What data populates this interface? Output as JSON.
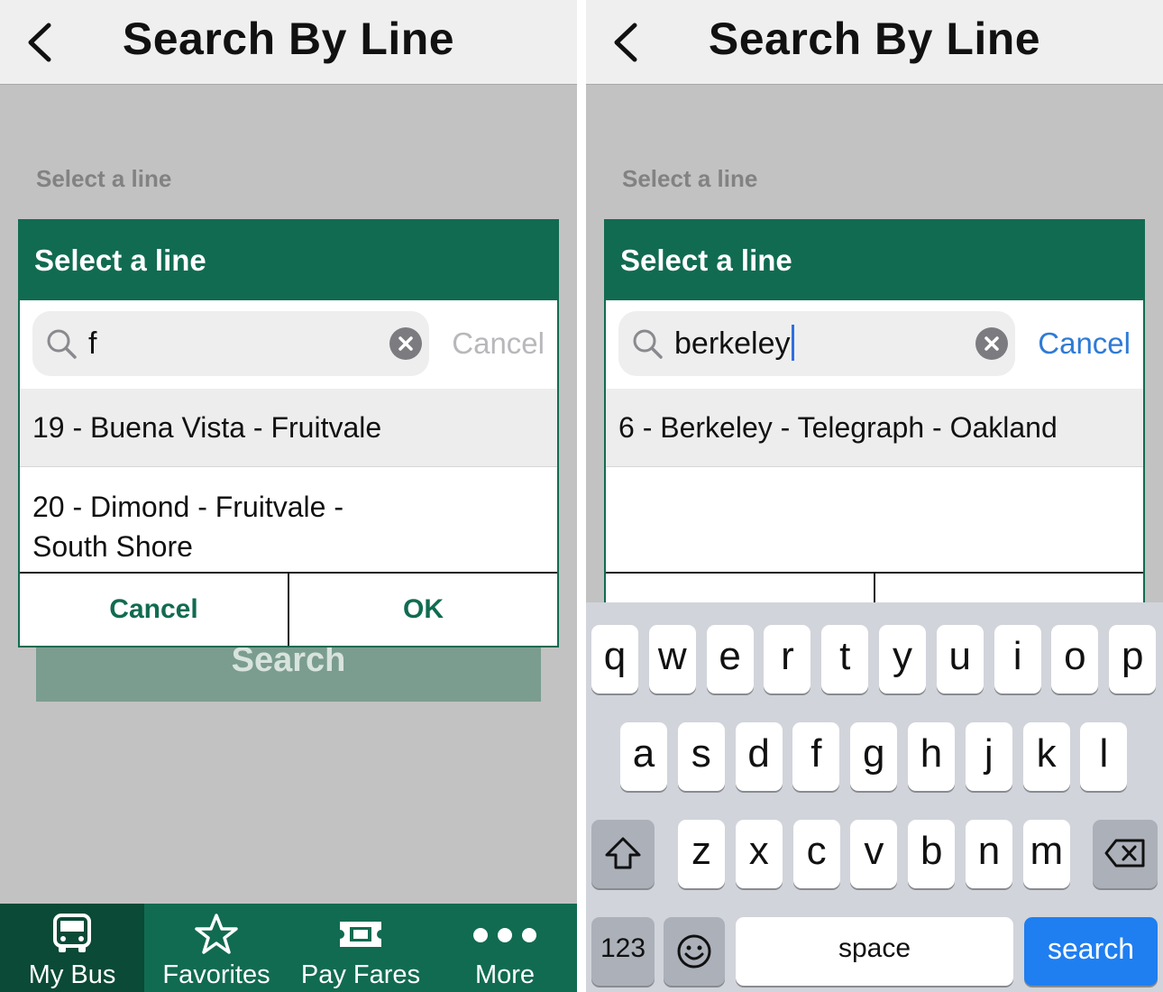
{
  "colors": {
    "brand_green": "#116b51",
    "tab_active": "#0a4a36",
    "ios_blue": "#2e7bd6",
    "search_key_blue": "#1f7ef0"
  },
  "left": {
    "nav_title": "Search By Line",
    "select_label": "Select a line",
    "search_button": "Search",
    "dialog": {
      "title": "Select a line",
      "search_value": "f",
      "cancel_link": "Cancel",
      "results": [
        "19 - Buena Vista - Fruitvale",
        "20 - Dimond - Fruitvale - South Shore"
      ],
      "cancel_button": "Cancel",
      "ok_button": "OK"
    },
    "tabs": [
      {
        "label": "My Bus",
        "icon": "bus-icon",
        "active": true
      },
      {
        "label": "Favorites",
        "icon": "star-icon",
        "active": false
      },
      {
        "label": "Pay Fares",
        "icon": "ticket-icon",
        "active": false
      },
      {
        "label": "More",
        "icon": "more-dots-icon",
        "active": false
      }
    ]
  },
  "right": {
    "nav_title": "Search By Line",
    "select_label": "Select a line",
    "dialog": {
      "title": "Select a line",
      "search_value": "berkeley",
      "cancel_link": "Cancel",
      "results": [
        "6 - Berkeley - Telegraph - Oakland"
      ]
    },
    "keyboard": {
      "row1": [
        "q",
        "w",
        "e",
        "r",
        "t",
        "y",
        "u",
        "i",
        "o",
        "p"
      ],
      "row2": [
        "a",
        "s",
        "d",
        "f",
        "g",
        "h",
        "j",
        "k",
        "l"
      ],
      "row3": [
        "z",
        "x",
        "c",
        "v",
        "b",
        "n",
        "m"
      ],
      "numbers_key": "123",
      "space_key": "space",
      "search_key": "search",
      "shift_icon": "shift-icon",
      "backspace_icon": "backspace-icon",
      "emoji_icon": "emoji-icon"
    }
  }
}
